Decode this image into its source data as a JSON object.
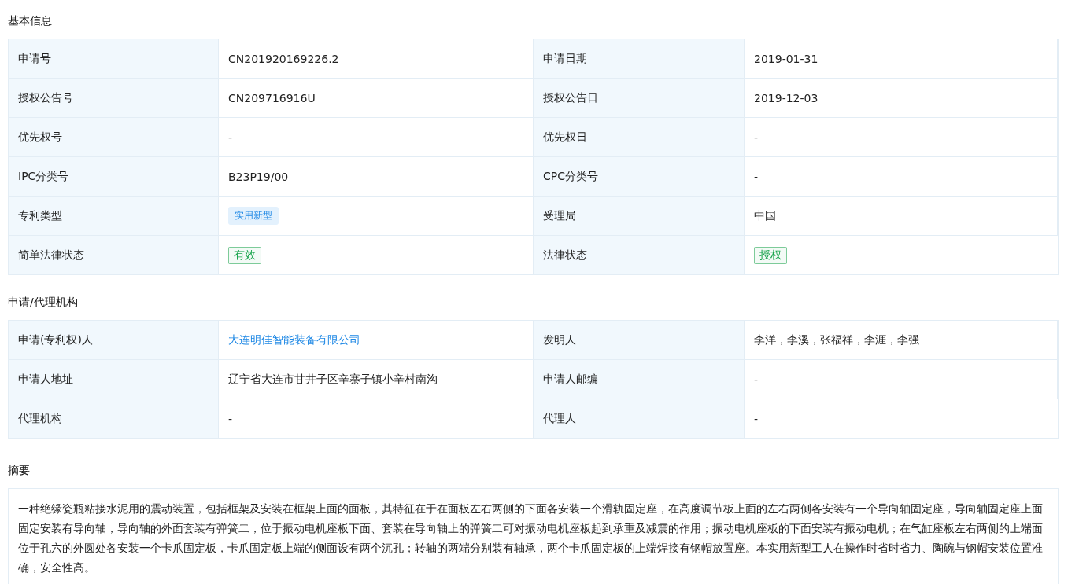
{
  "sections": [
    {
      "title": "基本信息",
      "rows": [
        [
          {
            "label": "申请号",
            "kind": "text",
            "value": "CN201920169226.2"
          },
          {
            "label": "申请日期",
            "kind": "text",
            "value": "2019-01-31"
          }
        ],
        [
          {
            "label": "授权公告号",
            "kind": "text",
            "value": "CN209716916U"
          },
          {
            "label": "授权公告日",
            "kind": "text",
            "value": "2019-12-03"
          }
        ],
        [
          {
            "label": "优先权号",
            "kind": "text",
            "value": "-"
          },
          {
            "label": "优先权日",
            "kind": "text",
            "value": "-"
          }
        ],
        [
          {
            "label": "IPC分类号",
            "kind": "text",
            "value": "B23P19/00"
          },
          {
            "label": "CPC分类号",
            "kind": "text",
            "value": "-"
          }
        ],
        [
          {
            "label": "专利类型",
            "kind": "chip",
            "value": "实用新型",
            "color": "#e3f1fd"
          },
          {
            "label": "受理局",
            "kind": "text",
            "value": "中国"
          }
        ],
        [
          {
            "label": "简单法律状态",
            "kind": "tag",
            "value": "有效",
            "color": "#16a34a"
          },
          {
            "label": "法律状态",
            "kind": "tag",
            "value": "授权",
            "color": "#16a34a"
          }
        ]
      ]
    },
    {
      "title": "申请/代理机构",
      "rows": [
        [
          {
            "label": "申请(专利权)人",
            "kind": "link",
            "value": "大连明佳智能装备有限公司"
          },
          {
            "label": "发明人",
            "kind": "text",
            "value": "李洋，李溪，张福祥，李涯，李强"
          }
        ],
        [
          {
            "label": "申请人地址",
            "kind": "text",
            "value": "辽宁省大连市甘井子区辛寨子镇小辛村南沟"
          },
          {
            "label": "申请人邮编",
            "kind": "text",
            "value": "-"
          }
        ],
        [
          {
            "label": "代理机构",
            "kind": "text",
            "value": "-"
          },
          {
            "label": "代理人",
            "kind": "text",
            "value": "-"
          }
        ]
      ]
    }
  ],
  "abstract": {
    "title": "摘要",
    "text": "一种绝缘瓷瓶粘接水泥用的震动装置，包括框架及安装在框架上面的面板，其特征在于在面板左右两侧的下面各安装一个滑轨固定座，在高度调节板上面的左右两侧各安装有一个导向轴固定座，导向轴固定座上面固定安装有导向轴，导向轴的外面套装有弹簧二，位于振动电机座板下面、套装在导向轴上的弹簧二可对振动电机座板起到承重及减震的作用；振动电机座板的下面安装有振动电机；在气缸座板左右两侧的上端面位于孔六的外圆处各安装一个卡爪固定板，卡爪固定板上端的侧面设有两个沉孔；转轴的两端分别装有轴承，两个卡爪固定板的上端焊接有钢帽放置座。本实用新型工人在操作时省时省力、陶碗与钢帽安装位置准确，安全性高。"
  }
}
